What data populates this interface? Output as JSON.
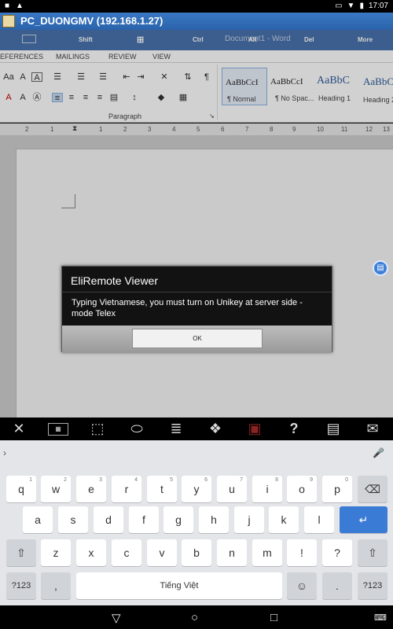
{
  "status_bar": {
    "time": "17:07"
  },
  "window": {
    "title": "PC_DUONGMV (192.168.1.27)"
  },
  "remote_keys": {
    "shift": "Shift",
    "ctrl": "Ctrl",
    "alt": "Alt",
    "del": "Del",
    "more": "More",
    "doc_title": "Document1 - Word"
  },
  "ribbon": {
    "tabs": [
      "EFERENCES",
      "MAILINGS",
      "REVIEW",
      "VIEW"
    ],
    "paragraph_label": "Paragraph",
    "styles": [
      {
        "sample": "AaBbCcI",
        "label": "¶ Normal"
      },
      {
        "sample": "AaBbCcI",
        "label": "¶ No Spac..."
      },
      {
        "sample": "AaBbC",
        "label": "Heading 1"
      },
      {
        "sample": "AaBbC",
        "label": "Heading 2"
      }
    ]
  },
  "ruler": {
    "ticks": [
      "2",
      "1",
      "1",
      "2",
      "3",
      "4",
      "5",
      "6",
      "7",
      "8",
      "9",
      "10",
      "11",
      "12",
      "13"
    ]
  },
  "dialog": {
    "title": "EliRemote Viewer",
    "message": "Typing Vietnamese, you must turn on Unikey at server side - mode Telex",
    "ok_label": "OK"
  },
  "toolbar": {
    "icons": [
      "wrench-icon",
      "keyboard-icon",
      "mouse-pointer-icon",
      "mouse-icon",
      "menu-icon",
      "windows-icon",
      "lock-icon",
      "help-icon",
      "list-icon",
      "mail-icon"
    ],
    "help_glyph": "?"
  },
  "keyboard": {
    "row1": [
      {
        "k": "q",
        "h": "1"
      },
      {
        "k": "w",
        "h": "2"
      },
      {
        "k": "e",
        "h": "3"
      },
      {
        "k": "r",
        "h": "4"
      },
      {
        "k": "t",
        "h": "5"
      },
      {
        "k": "y",
        "h": "6"
      },
      {
        "k": "u",
        "h": "7"
      },
      {
        "k": "i",
        "h": "8"
      },
      {
        "k": "o",
        "h": "9"
      },
      {
        "k": "p",
        "h": "0"
      }
    ],
    "row2": [
      "a",
      "s",
      "d",
      "f",
      "g",
      "h",
      "j",
      "k",
      "l"
    ],
    "row3": [
      "z",
      "x",
      "c",
      "v",
      "b",
      "n",
      "m",
      "!",
      "?"
    ],
    "sym_label": "?123",
    "comma": ",",
    "space_label": "Tiếng Việt",
    "period": "."
  },
  "colors": {
    "accent": "#3a7bd5",
    "title_bar": "#2f6fb8",
    "dialog_bg": "#121212"
  }
}
